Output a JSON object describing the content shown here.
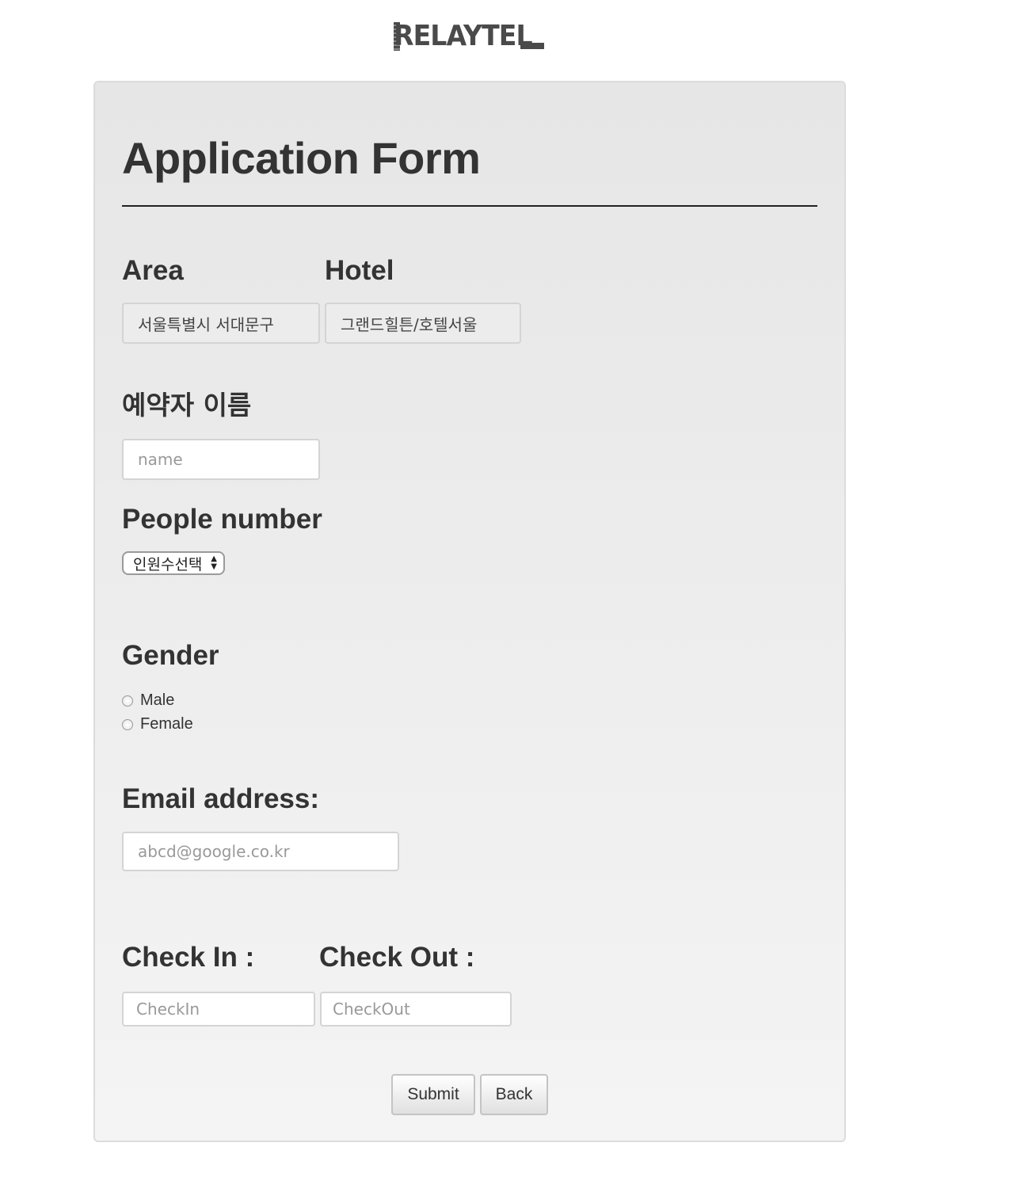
{
  "brand": {
    "logo_text": "RELAYTEL"
  },
  "form": {
    "title": "Application Form",
    "area": {
      "label": "Area",
      "value": "서울특별시 서대문구"
    },
    "hotel": {
      "label": "Hotel",
      "value": "그랜드힐튼/호텔서울"
    },
    "name": {
      "label": "예약자 이름",
      "placeholder": "name"
    },
    "people": {
      "label": "People number",
      "selected": "인원수선택"
    },
    "gender": {
      "label": "Gender",
      "options": [
        "Male",
        "Female"
      ]
    },
    "email": {
      "label": "Email address:",
      "placeholder": "abcd@google.co.kr"
    },
    "checkin": {
      "label": "Check In :",
      "placeholder": "CheckIn"
    },
    "checkout": {
      "label": "Check Out :",
      "placeholder": "CheckOut"
    },
    "buttons": {
      "submit": "Submit",
      "back": "Back"
    }
  },
  "colors": {
    "panel_top": "#e6e6e6",
    "panel_bottom": "#f4f4f4",
    "text": "#333333",
    "logo": "#4a4a4a"
  }
}
